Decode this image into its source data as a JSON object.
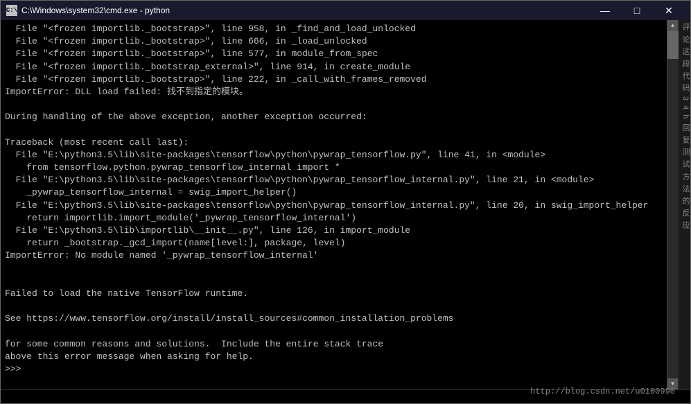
{
  "window": {
    "title": "C:\\Windows\\system32\\cmd.exe - python",
    "icon_label": "C:\\",
    "minimize_label": "—",
    "maximize_label": "□",
    "close_label": "✕"
  },
  "terminal": {
    "lines": [
      "  File \"<frozen importlib._bootstrap>\", line 958, in _find_and_load_unlocked",
      "  File \"<frozen importlib._bootstrap>\", line 666, in _load_unlocked",
      "  File \"<frozen importlib._bootstrap>\", line 577, in module_from_spec",
      "  File \"<frozen importlib._bootstrap_external>\", line 914, in create_module",
      "  File \"<frozen importlib._bootstrap>\", line 222, in _call_with_frames_removed",
      "ImportError: DLL load failed: 找不到指定的模块。",
      "",
      "During handling of the above exception, another exception occurred:",
      "",
      "Traceback (most recent call last):",
      "  File \"E:\\python3.5\\lib\\site-packages\\tensorflow\\python\\pywrap_tensorflow.py\", line 41, in <module>",
      "    from tensorflow.python.pywrap_tensorflow_internal import *",
      "  File \"E:\\python3.5\\lib\\site-packages\\tensorflow\\python\\pywrap_tensorflow_internal.py\", line 21, in <module>",
      "    _pywrap_tensorflow_internal = swig_import_helper()",
      "  File \"E:\\python3.5\\lib\\site-packages\\tensorflow\\python\\pywrap_tensorflow_internal.py\", line 20, in swig_import_helper",
      "    return importlib.import_module('_pywrap_tensorflow_internal')",
      "  File \"E:\\python3.5\\lib\\importlib\\__init__.py\", line 126, in import_module",
      "    return _bootstrap._gcd_import(name[level:], package, level)",
      "ImportError: No module named '_pywrap_tensorflow_internal'",
      "",
      "",
      "Failed to load the native TensorFlow runtime.",
      "",
      "See https://www.tensorflow.org/install/install_sources#common_installation_problems",
      "",
      "for some common reasons and solutions.  Include the entire stack trace",
      "above this error message when asking for help.",
      ">>>"
    ]
  },
  "sidebar": {
    "chars": "评论这段代码 3 4 h 回 复 测 试 方 法 的 反 应"
  },
  "watermark": {
    "text": "http://blog.csdn.net/u0100990"
  }
}
